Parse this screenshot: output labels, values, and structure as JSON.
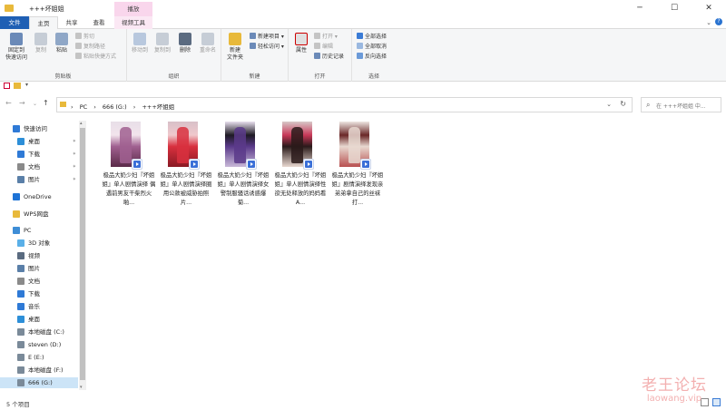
{
  "window": {
    "title": "+++坏姐姐",
    "minimize": "─",
    "maximize": "☐",
    "close": "✕"
  },
  "ribbon_tabs": {
    "file": "文件",
    "home": "主页",
    "share": "共享",
    "view": "查看",
    "context_header": "播放",
    "video_tools": "视频工具"
  },
  "ribbon": {
    "clipboard": {
      "pin_quick_access": "固定到\n快速访问",
      "copy": "复制",
      "paste": "粘贴",
      "cut": "剪切",
      "copy_path": "复制路径",
      "paste_shortcut": "粘贴快捷方式",
      "group_label": "剪贴板"
    },
    "organize": {
      "move_to": "移动到",
      "copy_to": "复制到",
      "delete": "删除",
      "rename": "重命名",
      "group_label": "组织"
    },
    "new": {
      "new_folder": "新建\n文件夹",
      "new_item": "新建项目 ▾",
      "easy_access": "轻松访问 ▾",
      "group_label": "新建"
    },
    "open": {
      "properties": "属性",
      "open": "打开 ▾",
      "edit": "编辑",
      "history": "历史记录",
      "group_label": "打开"
    },
    "select": {
      "select_all": "全部选择",
      "select_none": "全部取消",
      "invert": "反向选择",
      "group_label": "选择"
    }
  },
  "address": {
    "crumbs": [
      "PC",
      "›",
      "666 (G:)",
      "›",
      "+++坏姐姐"
    ],
    "search_placeholder": "在 +++坏姐姐 中..."
  },
  "nav": {
    "items": [
      {
        "label": "快速访问",
        "icon": "star-icon",
        "color": "#2f7ad6",
        "indent": 0,
        "pinned": false
      },
      {
        "label": "桌面",
        "icon": "desktop-icon",
        "color": "#2d8fd8",
        "indent": 1,
        "pinned": true
      },
      {
        "label": "下载",
        "icon": "download-icon",
        "color": "#2f7ad6",
        "indent": 1,
        "pinned": true
      },
      {
        "label": "文档",
        "icon": "documents-icon",
        "color": "#8a8a8a",
        "indent": 1,
        "pinned": true
      },
      {
        "label": "图片",
        "icon": "pictures-icon",
        "color": "#5a7fa8",
        "indent": 1,
        "pinned": true
      },
      {
        "label": "OneDrive",
        "icon": "cloud-icon",
        "color": "#1e73d6",
        "indent": 0,
        "pinned": false
      },
      {
        "label": "WPS网盘",
        "icon": "folder-icon",
        "color": "#e8b93b",
        "indent": 0,
        "pinned": false
      },
      {
        "label": "PC",
        "icon": "computer-icon",
        "color": "#3e8dd6",
        "indent": 0,
        "pinned": false
      },
      {
        "label": "3D 对象",
        "icon": "3d-objects-icon",
        "color": "#5ab0e8",
        "indent": 1,
        "pinned": false
      },
      {
        "label": "视频",
        "icon": "videos-icon",
        "color": "#5a6b80",
        "indent": 1,
        "pinned": false
      },
      {
        "label": "图片",
        "icon": "pictures-icon",
        "color": "#5a7fa8",
        "indent": 1,
        "pinned": false
      },
      {
        "label": "文档",
        "icon": "documents-icon",
        "color": "#8a8a8a",
        "indent": 1,
        "pinned": false
      },
      {
        "label": "下载",
        "icon": "download-icon",
        "color": "#2f7ad6",
        "indent": 1,
        "pinned": false
      },
      {
        "label": "音乐",
        "icon": "music-icon",
        "color": "#2f7ad6",
        "indent": 1,
        "pinned": false
      },
      {
        "label": "桌面",
        "icon": "desktop-icon",
        "color": "#2d8fd8",
        "indent": 1,
        "pinned": false
      },
      {
        "label": "本地磁盘 (C:)",
        "icon": "drive-icon",
        "color": "#7a8a99",
        "indent": 1,
        "pinned": false
      },
      {
        "label": "steven (D:)",
        "icon": "drive-icon",
        "color": "#7a8a99",
        "indent": 1,
        "pinned": false
      },
      {
        "label": "E (E:)",
        "icon": "drive-icon",
        "color": "#7a8a99",
        "indent": 1,
        "pinned": false
      },
      {
        "label": "本地磁盘 (F:)",
        "icon": "drive-icon",
        "color": "#7a8a99",
        "indent": 1,
        "pinned": false
      },
      {
        "label": "666 (G:)",
        "icon": "drive-icon",
        "color": "#7a8a99",
        "indent": 1,
        "pinned": false,
        "selected": true
      }
    ],
    "pin_glyph": "📌"
  },
  "files": [
    {
      "name": "极品大奶少妇『坏姐姐』单人剧情演绎 偶遇前男友干柴烈火啪...",
      "colors": [
        "#e8dfe8",
        "#a06090",
        "#f2e4ec",
        "#5a2a48"
      ]
    },
    {
      "name": "极品大奶少妇『坏姐姐』单人剧情演绎圈用公款被威胁拍照片...",
      "colors": [
        "#d8c0c8",
        "#d8303e",
        "#f0c8cc",
        "#8a1a24"
      ]
    },
    {
      "name": "极品大奶少妇『坏姐姐』单人剧情演绎女警制服骚话诱惑爆菊...",
      "colors": [
        "#e8e0ee",
        "#5a3a8a",
        "#1e1a24",
        "#c8b8d8"
      ]
    },
    {
      "name": "极品大奶少妇『坏姐姐』单人剧情演绎性欲无处释放的妈妈看A...",
      "colors": [
        "#d8c8c8",
        "#2a1a1a",
        "#c83858",
        "#e8d8d0"
      ]
    },
    {
      "name": "极品大奶少妇『坏姐姐』剧情演绎发现亲弟弟拿自己的丝袜打...",
      "colors": [
        "#eee6e2",
        "#e8d8d0",
        "#6a2828",
        "#b85050"
      ]
    }
  ],
  "status": {
    "count": "5 个项目"
  },
  "watermark": {
    "line1": "老王论坛",
    "line2": "laowang.vip"
  },
  "accent": "#1f5fb4"
}
